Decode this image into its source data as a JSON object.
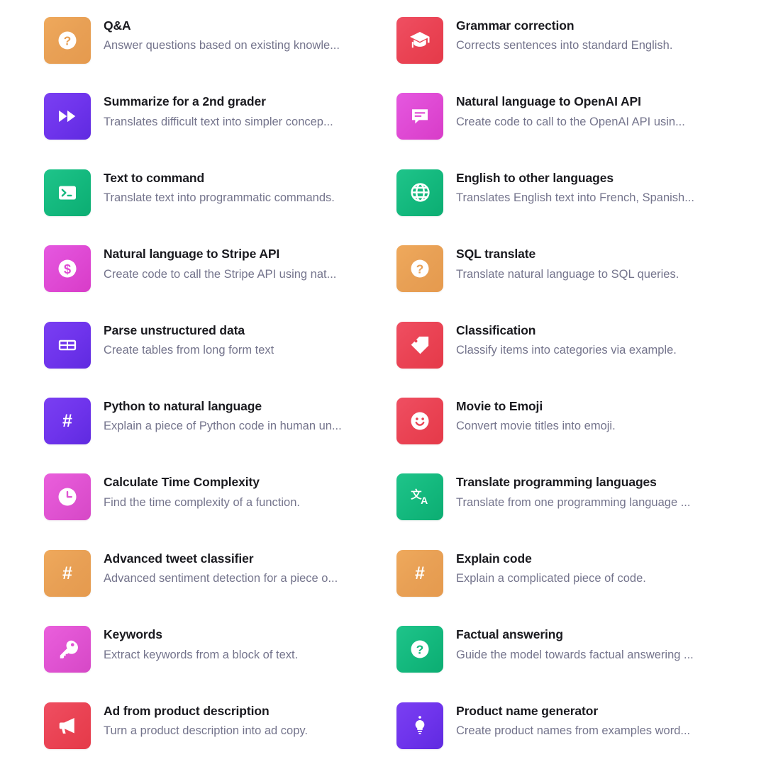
{
  "page": {
    "title": "Prompt examples gallery",
    "columns": 2,
    "colors": {
      "background": "#ffffff",
      "title_text": "#1a1a1f",
      "description_text": "#74748c",
      "orange": "#e8a055",
      "purple": "#6f34ec",
      "green": "#14b97e",
      "magenta": "#df4ad4",
      "red": "#ea4354",
      "pink": "#e053d2"
    }
  },
  "cards": [
    {
      "title": "Q&A",
      "description": "Answer questions based on existing knowle...",
      "icon": "question-mark-circle-icon",
      "color": "orange"
    },
    {
      "title": "Grammar correction",
      "description": "Corrects sentences into standard English.",
      "icon": "graduation-cap-icon",
      "color": "red"
    },
    {
      "title": "Summarize for a 2nd grader",
      "description": "Translates difficult text into simpler concep...",
      "icon": "fast-forward-icon",
      "color": "purple"
    },
    {
      "title": "Natural language to OpenAI API",
      "description": "Create code to call to the OpenAI API usin...",
      "icon": "chat-bubble-icon",
      "color": "magenta"
    },
    {
      "title": "Text to command",
      "description": "Translate text into programmatic commands.",
      "icon": "terminal-icon",
      "color": "green"
    },
    {
      "title": "English to other languages",
      "description": "Translates English text into French, Spanish...",
      "icon": "globe-icon",
      "color": "green"
    },
    {
      "title": "Natural language to Stripe API",
      "description": "Create code to call the Stripe API using nat...",
      "icon": "dollar-circle-icon",
      "color": "magenta"
    },
    {
      "title": "SQL translate",
      "description": "Translate natural language to SQL queries.",
      "icon": "question-mark-circle-icon",
      "color": "orange"
    },
    {
      "title": "Parse unstructured data",
      "description": "Create tables from long form text",
      "icon": "table-icon",
      "color": "purple"
    },
    {
      "title": "Classification",
      "description": "Classify items into categories via example.",
      "icon": "tag-icon",
      "color": "red"
    },
    {
      "title": "Python to natural language",
      "description": "Explain a piece of Python code in human un...",
      "icon": "hash-icon",
      "color": "purple"
    },
    {
      "title": "Movie to Emoji",
      "description": "Convert movie titles into emoji.",
      "icon": "smiley-face-icon",
      "color": "red"
    },
    {
      "title": "Calculate Time Complexity",
      "description": "Find the time complexity of a function.",
      "icon": "clock-icon",
      "color": "pink"
    },
    {
      "title": "Translate programming languages",
      "description": "Translate from one programming language ...",
      "icon": "translate-icon",
      "color": "green"
    },
    {
      "title": "Advanced tweet classifier",
      "description": "Advanced sentiment detection for a piece o...",
      "icon": "hash-icon",
      "color": "orange"
    },
    {
      "title": "Explain code",
      "description": "Explain a complicated piece of code.",
      "icon": "hash-icon",
      "color": "orange"
    },
    {
      "title": "Keywords",
      "description": "Extract keywords from a block of text.",
      "icon": "key-icon",
      "color": "pink"
    },
    {
      "title": "Factual answering",
      "description": "Guide the model towards factual answering ...",
      "icon": "question-mark-circle-icon",
      "color": "green"
    },
    {
      "title": "Ad from product description",
      "description": "Turn a product description into ad copy.",
      "icon": "megaphone-icon",
      "color": "red"
    },
    {
      "title": "Product name generator",
      "description": "Create product names from examples word...",
      "icon": "lightbulb-icon",
      "color": "purple"
    }
  ]
}
